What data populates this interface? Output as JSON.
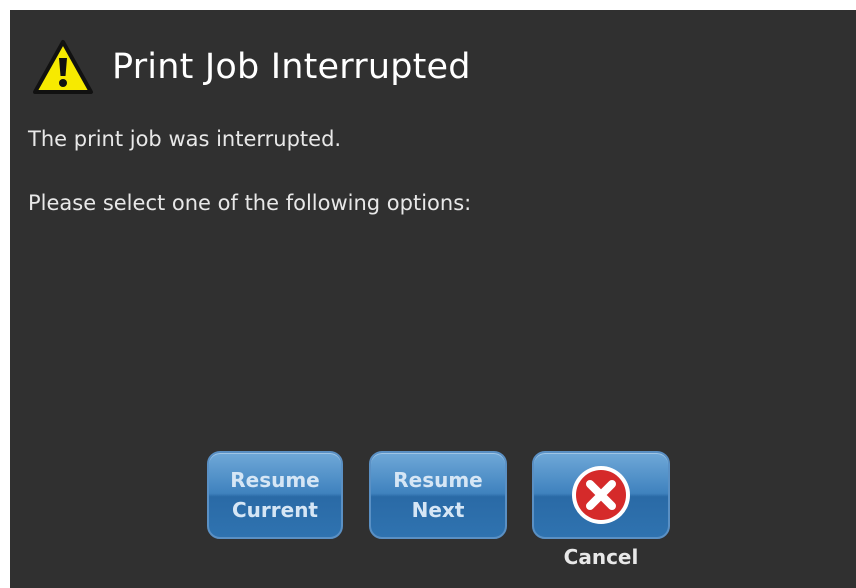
{
  "dialog": {
    "title": "Print Job Interrupted",
    "icon": "warning-icon",
    "message_line1": "The print job was interrupted.",
    "message_line2": "Please select one of the following options:"
  },
  "buttons": {
    "resume_current": "Resume\nCurrent",
    "resume_next": "Resume\nNext",
    "cancel_icon": "close-icon",
    "cancel_label": "Cancel"
  },
  "colors": {
    "background": "#303030",
    "button_blue": "#3f82be",
    "warning_yellow": "#f5e800",
    "cancel_red": "#d32f2f"
  }
}
